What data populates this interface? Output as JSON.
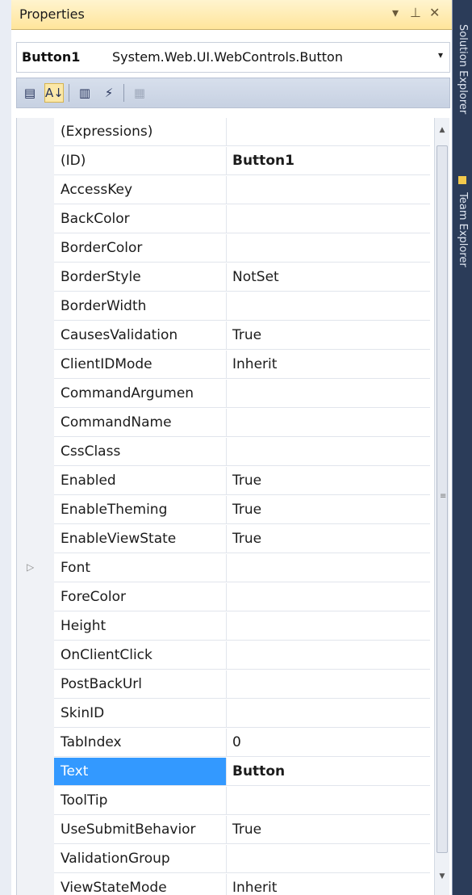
{
  "window": {
    "title": "Properties",
    "controls": {
      "dropdown": "▾",
      "pin": "⊥",
      "close": "✕"
    }
  },
  "selector": {
    "object_name": "Button1",
    "object_type": "System.Web.UI.WebControls.Button",
    "dropdown_glyph": "▾"
  },
  "toolbar": {
    "categorized_glyph": "▤",
    "alphabetical_glyph": "A↓",
    "properties_glyph": "▥",
    "events_glyph": "⚡",
    "property_pages_glyph": "▦"
  },
  "side_tabs": {
    "solution_explorer": "Solution Explorer",
    "team_explorer": "Team Explorer"
  },
  "colors": {
    "selection": "#3399ff",
    "title_bar": "#ffe59b",
    "dock_strip": "#2b3c59"
  },
  "properties": [
    {
      "name": "(Expressions)",
      "value": ""
    },
    {
      "name": "(ID)",
      "value": "Button1",
      "bold": true
    },
    {
      "name": "AccessKey",
      "value": ""
    },
    {
      "name": "BackColor",
      "value": ""
    },
    {
      "name": "BorderColor",
      "value": ""
    },
    {
      "name": "BorderStyle",
      "value": "NotSet"
    },
    {
      "name": "BorderWidth",
      "value": ""
    },
    {
      "name": "CausesValidation",
      "value": "True"
    },
    {
      "name": "ClientIDMode",
      "value": "Inherit"
    },
    {
      "name": "CommandArgumen",
      "value": ""
    },
    {
      "name": "CommandName",
      "value": ""
    },
    {
      "name": "CssClass",
      "value": ""
    },
    {
      "name": "Enabled",
      "value": "True"
    },
    {
      "name": "EnableTheming",
      "value": "True"
    },
    {
      "name": "EnableViewState",
      "value": "True"
    },
    {
      "name": "Font",
      "value": "",
      "expandable": true
    },
    {
      "name": "ForeColor",
      "value": ""
    },
    {
      "name": "Height",
      "value": ""
    },
    {
      "name": "OnClientClick",
      "value": ""
    },
    {
      "name": "PostBackUrl",
      "value": ""
    },
    {
      "name": "SkinID",
      "value": ""
    },
    {
      "name": "TabIndex",
      "value": "0"
    },
    {
      "name": "Text",
      "value": "Button",
      "bold": true,
      "selected": true
    },
    {
      "name": "ToolTip",
      "value": ""
    },
    {
      "name": "UseSubmitBehavior",
      "value": "True"
    },
    {
      "name": "ValidationGroup",
      "value": ""
    },
    {
      "name": "ViewStateMode",
      "value": "Inherit"
    }
  ]
}
